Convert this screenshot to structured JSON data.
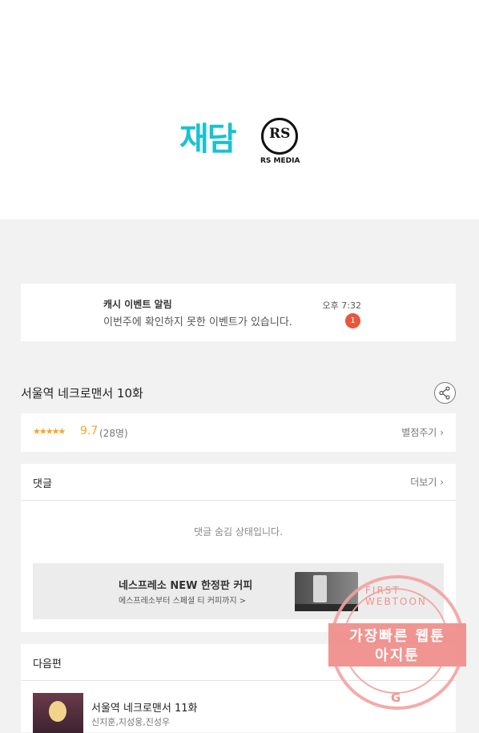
{
  "header": {
    "logo_jaedam": "재담",
    "logo_rs": "RS",
    "logo_rs_media": "RS MEDIA"
  },
  "notice": {
    "title": "캐시 이벤트 알림",
    "time": "오후 7:32",
    "body": "이번주에 확인하지 못한 이벤트가 있습니다.",
    "badge": "1"
  },
  "episode": {
    "title": "서울역 네크로맨서 10화",
    "share_icon": "share-icon"
  },
  "rating": {
    "stars": "★★★★★",
    "score": "9.7",
    "count": "(28명)",
    "link": "별점주기"
  },
  "comments": {
    "header": "댓글",
    "more": "더보기",
    "hidden_message": "댓글 숨김 상태입니다."
  },
  "ad": {
    "title": "네스프레소 NEW 한정판 커피",
    "subtitle": "에스프레소부터 스페셜 티 커피까지 >"
  },
  "next": {
    "header": "다음편",
    "title": "서울역 네크로맨서 11화",
    "author": "신지훈,지성웅,진성우"
  },
  "watermark": {
    "ring_text": "FIRST WEBTOON",
    "line1": "가장빠른 웹툰",
    "line2": "아지툰",
    "logo": "G"
  },
  "colors": {
    "accent_cyan": "#19c2d1",
    "star_orange": "#f5a623",
    "badge_red": "#e8563b",
    "stamp_pink": "#ef8a86"
  }
}
